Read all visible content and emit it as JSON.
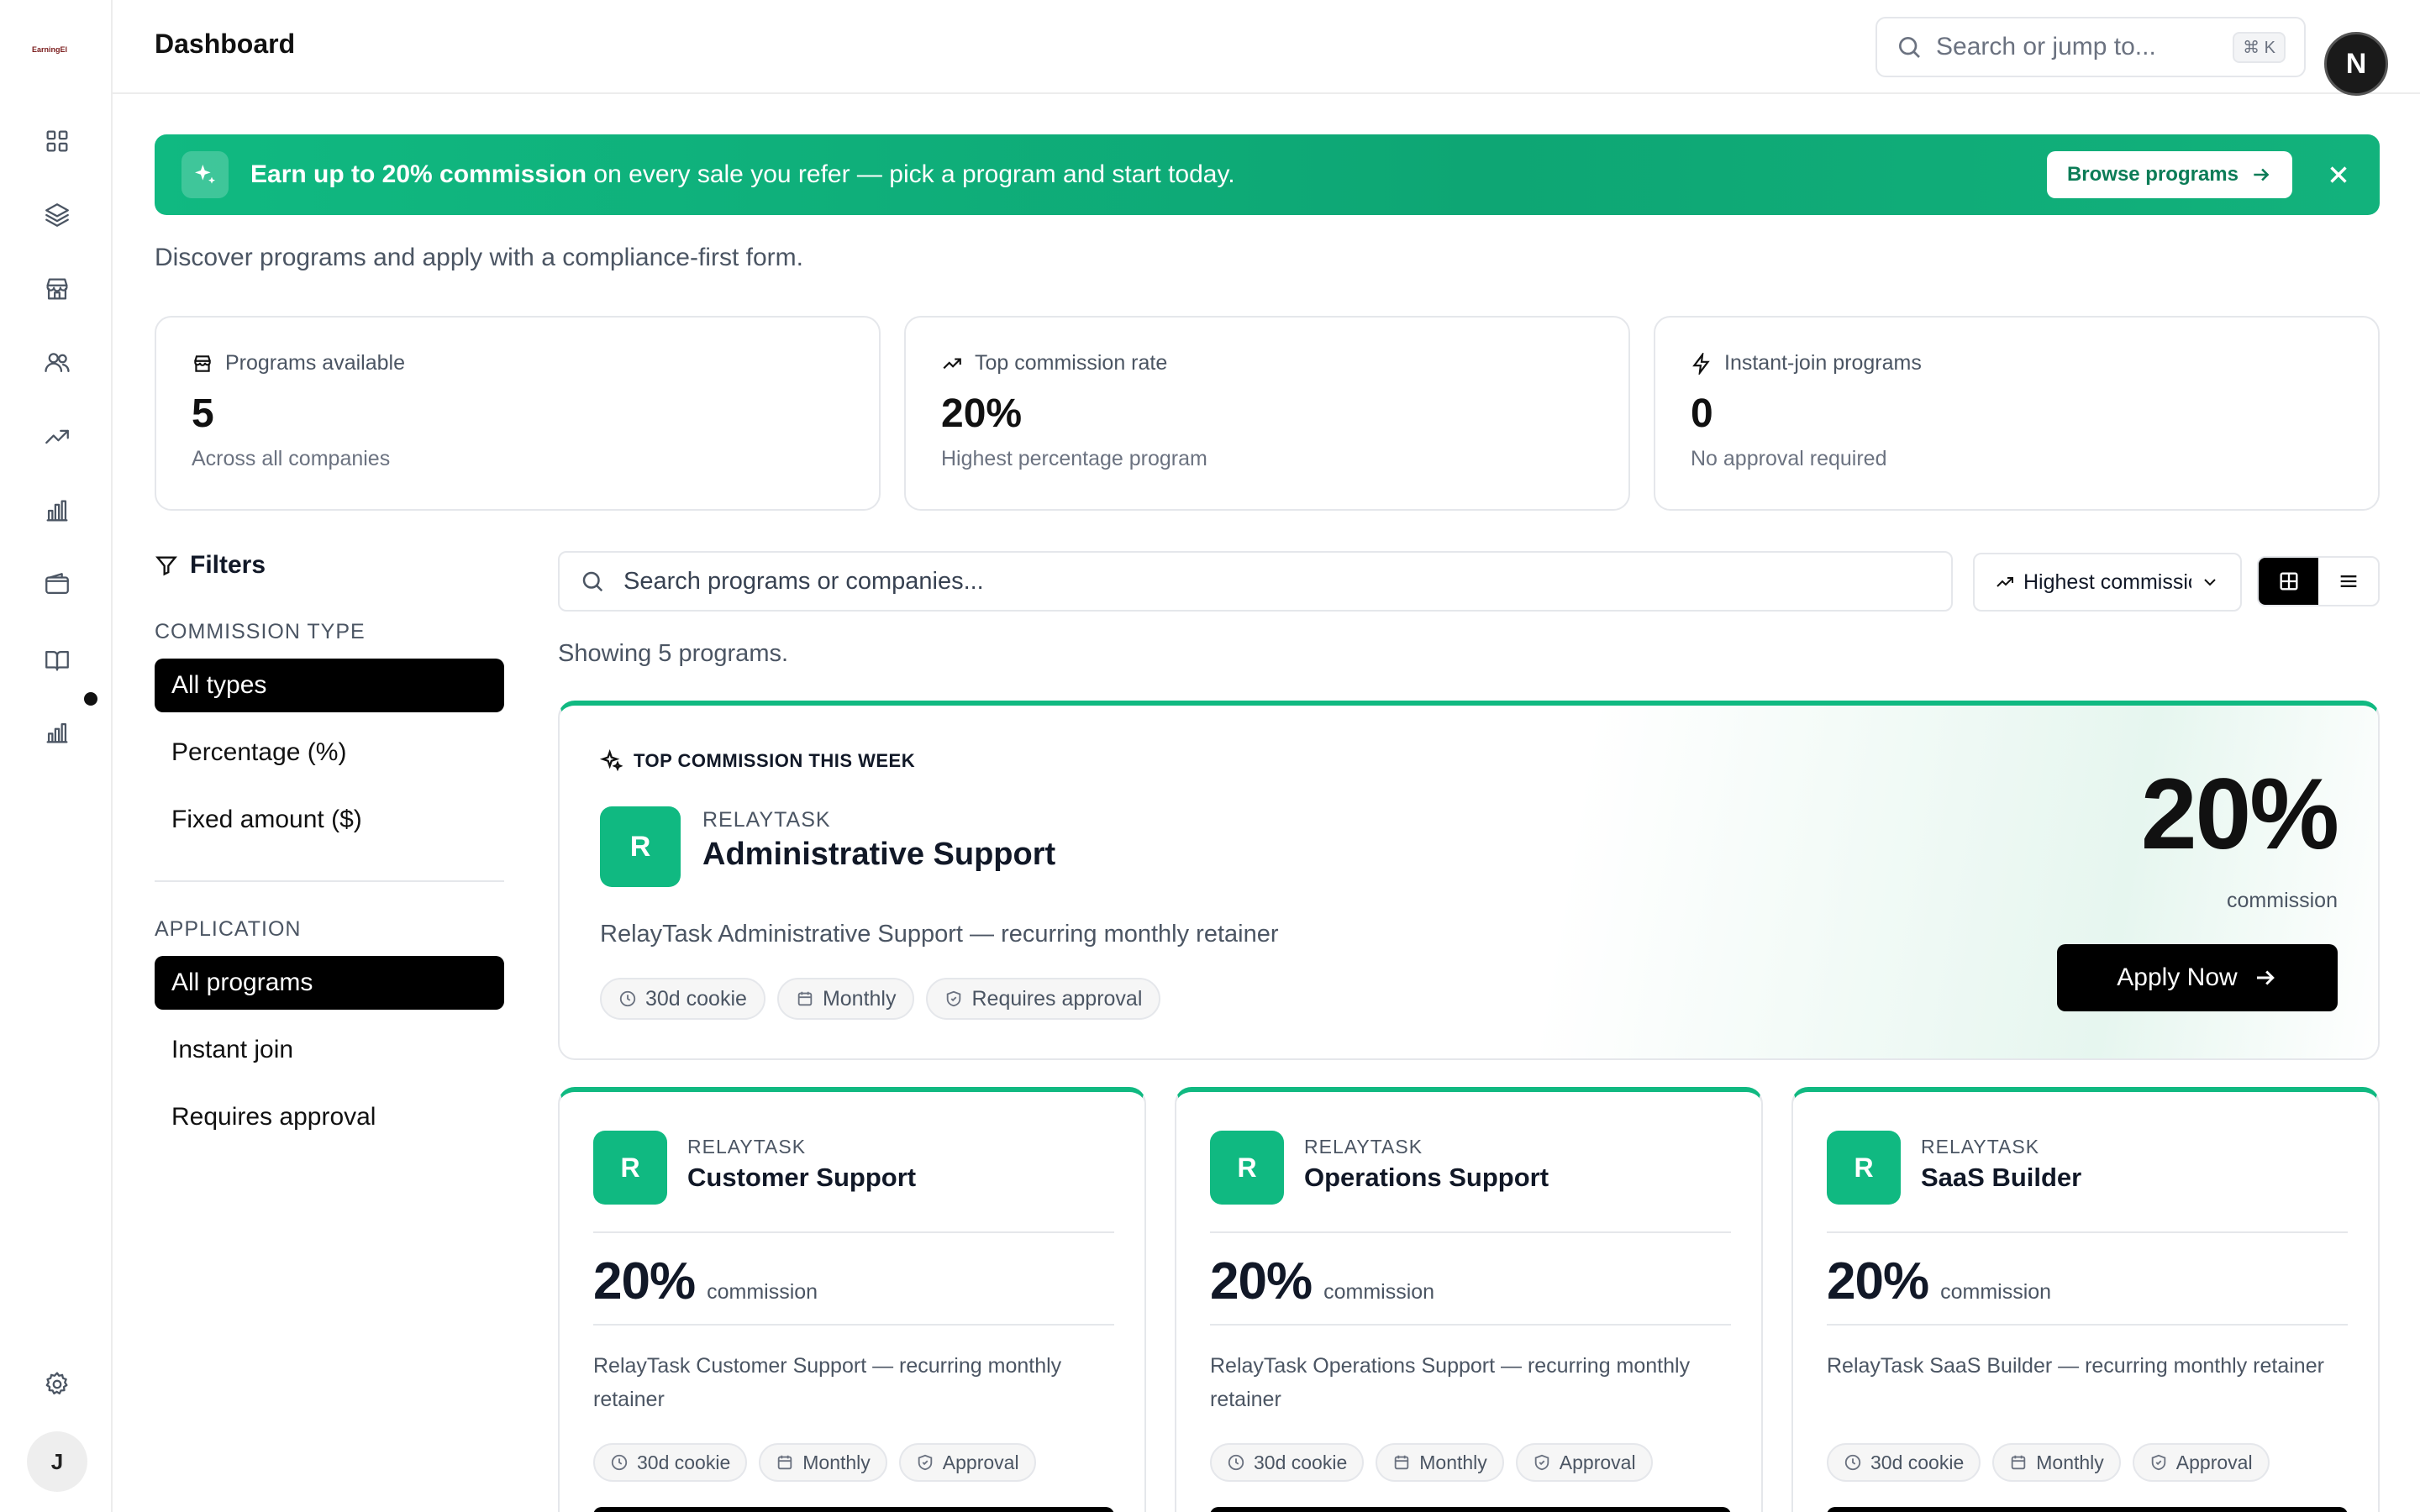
{
  "sidebar": {
    "logo_text": "EarningEl",
    "nav_icons": [
      "dashboard-icon",
      "layers-icon",
      "store-icon",
      "users-icon",
      "trending-icon",
      "bar-chart-icon",
      "wallet-icon",
      "book-icon",
      "analytics-icon"
    ],
    "settings_icon": "gear-icon",
    "user_initial": "J"
  },
  "header": {
    "title": "Dashboard",
    "search_placeholder": "Search or jump to...",
    "search_shortcut": "⌘ K",
    "avatar_initial": "N"
  },
  "banner": {
    "bold_text": "Earn up to 20% commission",
    "text": " on every sale you refer — pick a program and start today.",
    "button_label": "Browse programs",
    "accent_color": "#10b981"
  },
  "subtitle": "Discover programs and apply with a compliance-first form.",
  "stats": [
    {
      "label": "Programs available",
      "value": "5",
      "sub": "Across all companies",
      "icon": "store-icon"
    },
    {
      "label": "Top commission rate",
      "value": "20%",
      "sub": "Highest percentage program",
      "icon": "trending-up-icon"
    },
    {
      "label": "Instant-join programs",
      "value": "0",
      "sub": "No approval required",
      "icon": "bolt-icon"
    }
  ],
  "filters": {
    "title": "Filters",
    "commission_type": {
      "label": "COMMISSION TYPE",
      "options": [
        "All types",
        "Percentage (%)",
        "Fixed amount ($)"
      ],
      "selected": "All types"
    },
    "application": {
      "label": "APPLICATION",
      "options": [
        "All programs",
        "Instant join",
        "Requires approval"
      ],
      "selected": "All programs"
    }
  },
  "toolbar": {
    "search_placeholder": "Search programs or companies...",
    "sort_value": "Highest commission",
    "view_mode": "grid"
  },
  "showing_text": "Showing 5 programs.",
  "featured": {
    "tag": "TOP COMMISSION THIS WEEK",
    "company": "RELAYTASK",
    "company_initial": "R",
    "name": "Administrative Support",
    "description": "RelayTask Administrative Support — recurring monthly retainer",
    "pills": [
      "30d cookie",
      "Monthly",
      "Requires approval"
    ],
    "rate": "20%",
    "rate_label": "commission",
    "apply_label": "Apply Now"
  },
  "programs": [
    {
      "company": "RELAYTASK",
      "initial": "R",
      "name": "Customer Support",
      "rate": "20%",
      "rate_label": "commission",
      "description": "RelayTask Customer Support — recurring monthly retainer",
      "pills": [
        "30d cookie",
        "Monthly",
        "Approval"
      ]
    },
    {
      "company": "RELAYTASK",
      "initial": "R",
      "name": "Operations Support",
      "rate": "20%",
      "rate_label": "commission",
      "description": "RelayTask Operations Support — recurring monthly retainer",
      "pills": [
        "30d cookie",
        "Monthly",
        "Approval"
      ]
    },
    {
      "company": "RELAYTASK",
      "initial": "R",
      "name": "SaaS Builder",
      "rate": "20%",
      "rate_label": "commission",
      "description": "RelayTask SaaS Builder — recurring monthly retainer",
      "pills": [
        "30d cookie",
        "Monthly",
        "Approval"
      ]
    }
  ]
}
